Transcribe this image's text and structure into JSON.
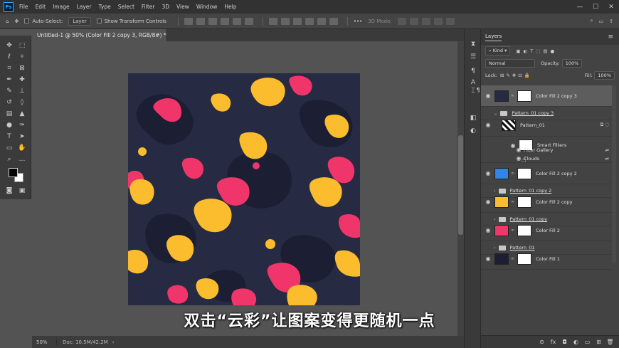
{
  "app": {
    "logo": "Ps",
    "menu": [
      "File",
      "Edit",
      "Image",
      "Layer",
      "Type",
      "Select",
      "Filter",
      "3D",
      "View",
      "Window",
      "Help"
    ],
    "window_controls": [
      "—",
      "☐",
      "✕"
    ]
  },
  "options_bar": {
    "auto_select_label": "Auto-Select:",
    "auto_select_value": "Layer",
    "transform_label": "Show Transform Controls",
    "mode_3d_label": "3D Mode:",
    "more": "•••"
  },
  "document": {
    "tab_title": "Untitled-1 @ 50% (Color Fill 2 copy 3, RGB/8#) *",
    "close": "×"
  },
  "status": {
    "zoom": "50%",
    "doc": "Doc: 10.5M/42.2M"
  },
  "subtitle": "双击“云彩”让图案变得更随机一点",
  "colors": {
    "navy": "#262a42",
    "dark_navy": "#1c1f33",
    "pink": "#f0356a",
    "yellow": "#fbbd2e",
    "blue_fill": "#2f86e8",
    "accent_ps": "#31a8ff"
  },
  "layers_panel": {
    "tab": "Layers",
    "menu_icon": "≡",
    "kind_label": "Kind",
    "blend_mode": "Normal",
    "opacity_label": "Opacity:",
    "opacity_value": "100%",
    "lock_label": "Lock:",
    "fill_label": "Fill:",
    "fill_value": "100%",
    "layers": [
      {
        "name": "Color Fill 2 copy 3",
        "type": "fill",
        "color": "#262a42"
      },
      {
        "name": "Pattern_01 copy 3",
        "type": "group"
      },
      {
        "name": "Pattern_01",
        "type": "smart"
      },
      {
        "name": "Smart Filters",
        "type": "filters"
      },
      {
        "name": "Filter Gallery",
        "type": "filter"
      },
      {
        "name": "Clouds",
        "type": "filter"
      },
      {
        "name": "Color Fill 2 copy 2",
        "type": "fill",
        "color": "#2f86e8"
      },
      {
        "name": "Pattern_01 copy 2",
        "type": "group"
      },
      {
        "name": "Color Fill 2 copy",
        "type": "fill",
        "color": "#fbbd2e"
      },
      {
        "name": "Pattern_01 copy",
        "type": "group"
      },
      {
        "name": "Color Fill 2",
        "type": "fill",
        "color": "#f0356a"
      },
      {
        "name": "Pattern_01",
        "type": "group"
      },
      {
        "name": "Color Fill 1",
        "type": "fill",
        "color": "#1c1f33"
      }
    ],
    "footer_icons": [
      "link-icon",
      "fx-icon",
      "mask-icon",
      "adjustment-icon",
      "group-icon",
      "new-layer-icon",
      "trash-icon"
    ],
    "footer_glyphs": [
      "⊝",
      "fx",
      "◘",
      "◐",
      "▭",
      "⊞",
      "🗑"
    ]
  }
}
